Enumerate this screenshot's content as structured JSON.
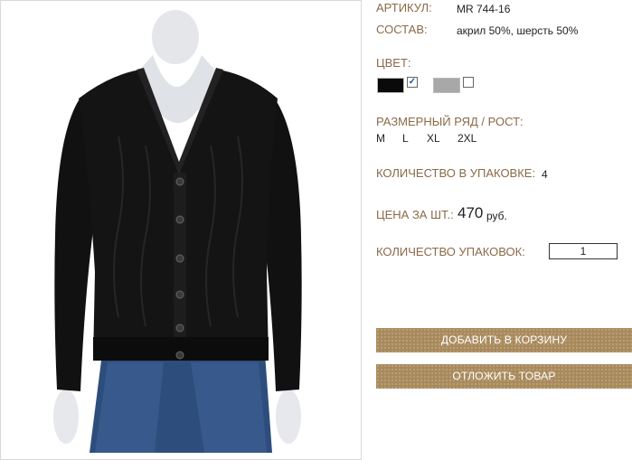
{
  "product": {
    "article_label": "АРТИКУЛ:",
    "article_value": "MR 744-16",
    "composition_label": "СОСТАВ:",
    "composition_value": "акрил 50%, шерсть 50%",
    "color_label": "ЦВЕТ:",
    "colors": [
      {
        "name": "black",
        "hex": "#0a0a0a",
        "checked": true
      },
      {
        "name": "grey",
        "hex": "#a8a8a8",
        "checked": false
      }
    ],
    "sizes_label": "РАЗМЕРНЫЙ РЯД / РОСТ:",
    "sizes": [
      "M",
      "L",
      "XL",
      "2XL"
    ],
    "pack_qty_label": "КОЛИЧЕСТВО В УПАКОВКЕ:",
    "pack_qty_value": "4",
    "price_label": "ЦЕНА ЗА ШТ.:",
    "price_value": "470",
    "price_currency": "руб.",
    "packs_label": "КОЛИЧЕСТВО УПАКОВОК:",
    "packs_value": "1"
  },
  "actions": {
    "add_to_cart": "ДОБАВИТЬ В КОРЗИНУ",
    "defer": "ОТЛОЖИТЬ ТОВАР"
  },
  "colors": {
    "label": "#8a6a47",
    "button": "#a98a5c"
  }
}
